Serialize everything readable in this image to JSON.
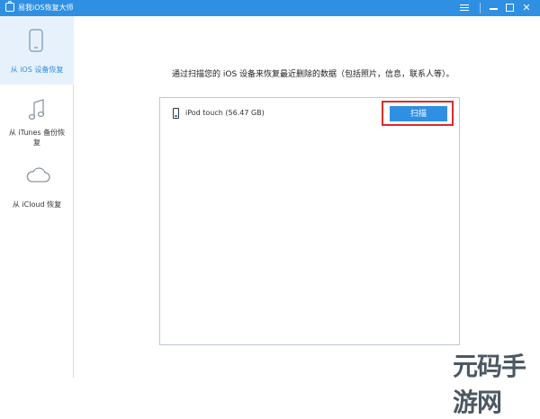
{
  "titlebar": {
    "title": "易我iOS恢复大师"
  },
  "sidebar": {
    "items": [
      {
        "label": "从 iOS 设备恢复",
        "icon": "phone-icon"
      },
      {
        "label": "从 iTunes 备份恢复",
        "icon": "music-note-icon"
      },
      {
        "label": "从 iCloud 恢复",
        "icon": "cloud-icon"
      }
    ]
  },
  "main": {
    "instruction": "通过扫描您的 iOS 设备来恢复最近删除的数据（包括照片，信息，联系人等）。",
    "device": {
      "name": "iPod touch (56.47 GB)"
    },
    "scan_button": "扫描"
  },
  "watermark": {
    "text": "元码手游网"
  },
  "colors": {
    "accent": "#2f8fe3",
    "highlight": "#d92b2b"
  }
}
